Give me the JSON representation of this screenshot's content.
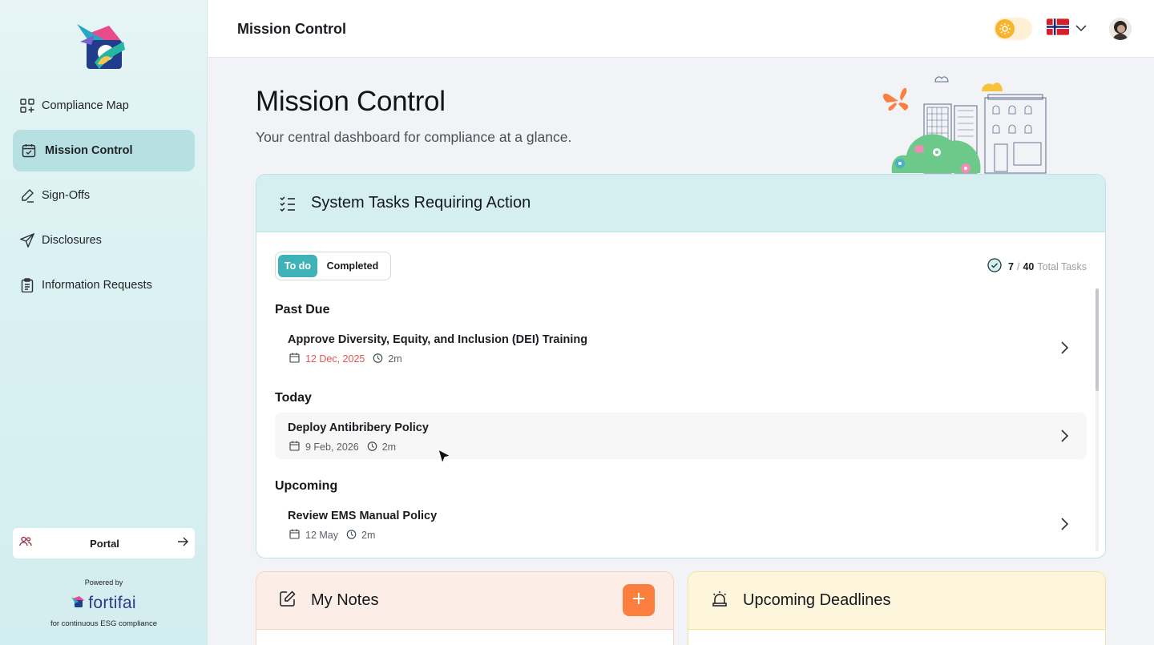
{
  "sidebar": {
    "nav": [
      {
        "label": "Compliance Map",
        "icon": "grid-plus-icon",
        "active": false
      },
      {
        "label": "Mission Control",
        "icon": "calendar-check-icon",
        "active": true
      },
      {
        "label": "Sign-Offs",
        "icon": "pen-icon",
        "active": false
      },
      {
        "label": "Disclosures",
        "icon": "send-icon",
        "active": false
      },
      {
        "label": "Information Requests",
        "icon": "clipboard-icon",
        "active": false
      }
    ],
    "portal_label": "Portal",
    "powered_by": "Powered by",
    "brand": "fortifai",
    "tagline": "for continuous ESG compliance"
  },
  "header": {
    "title": "Mission Control",
    "theme_toggle": "sun-icon",
    "language_flag": "norway-flag-icon"
  },
  "main": {
    "title": "Mission Control",
    "subtitle": "Your central dashboard for compliance at a glance."
  },
  "tasks": {
    "title": "System Tasks Requiring Action",
    "tabs": [
      "To do",
      "Completed"
    ],
    "active_tab": "To do",
    "completed_count": "7",
    "separator": "/",
    "total_count": "40",
    "total_label": "Total Tasks",
    "sections": [
      {
        "heading": "Past Due",
        "items": [
          {
            "name": "Approve Diversity, Equity, and Inclusion (DEI) Training",
            "date": "12 Dec, 2025",
            "duration": "2m",
            "overdue": true
          }
        ]
      },
      {
        "heading": "Today",
        "items": [
          {
            "name": "Deploy Antibribery Policy",
            "date": "9 Feb, 2026",
            "duration": "2m",
            "overdue": false
          }
        ]
      },
      {
        "heading": "Upcoming",
        "items": [
          {
            "name": "Review EMS Manual Policy",
            "date": "12 May",
            "duration": "2m",
            "overdue": false
          }
        ]
      }
    ]
  },
  "notes": {
    "title": "My Notes",
    "add_icon": "plus-icon"
  },
  "deadlines": {
    "title": "Upcoming Deadlines",
    "icon": "alarm-bell-icon"
  },
  "colors": {
    "accent": "#3fb2b7",
    "active_nav": "#b7e0e3",
    "overdue": "#e25555",
    "add_button": "#fb7f3e"
  }
}
